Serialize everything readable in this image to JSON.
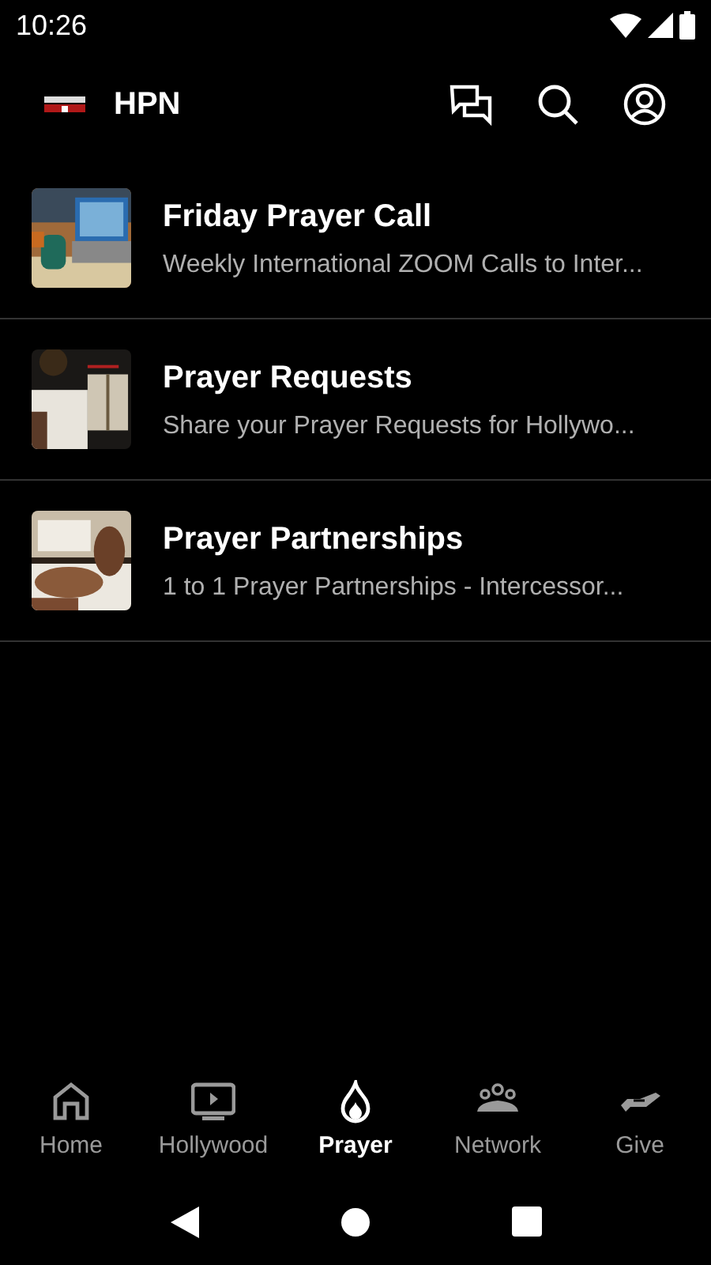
{
  "status_bar": {
    "time": "10:26"
  },
  "app_bar": {
    "title": "HPN"
  },
  "items": [
    {
      "title": "Friday Prayer Call",
      "subtitle": "Weekly International ZOOM Calls to Inter..."
    },
    {
      "title": "Prayer Requests",
      "subtitle": "Share your Prayer Requests for Hollywo..."
    },
    {
      "title": "Prayer Partnerships",
      "subtitle": "1 to 1 Prayer Partnerships - Intercessor..."
    }
  ],
  "bottom_nav": [
    {
      "label": "Home",
      "kind": "home",
      "selected": false
    },
    {
      "label": "Hollywood",
      "kind": "tv",
      "selected": false
    },
    {
      "label": "Prayer",
      "kind": "flame",
      "selected": true
    },
    {
      "label": "Network",
      "kind": "people",
      "selected": false
    },
    {
      "label": "Give",
      "kind": "hand",
      "selected": false
    }
  ]
}
